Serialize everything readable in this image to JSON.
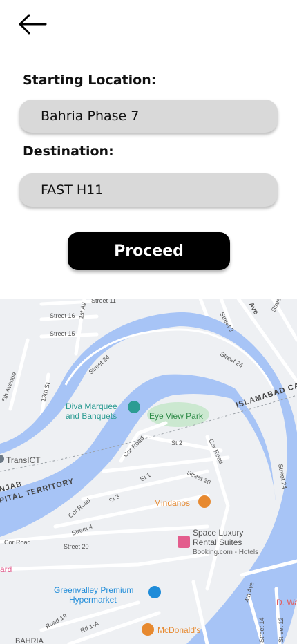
{
  "header": {
    "back_icon": "arrow-left-icon"
  },
  "form": {
    "start_label": "Starting Location:",
    "start_value": "Bahria Phase 7",
    "destination_label": "Destination:",
    "destination_value": "FAST H11",
    "proceed_label": "Proceed"
  },
  "map": {
    "streets": {
      "street_11": "Street 11",
      "street_16": "Street 16",
      "street_15": "Street 15",
      "street_24_a": "Street 24",
      "street_24_b": "Street 24",
      "street_24_c": "Street 24",
      "street_2": "Street 2",
      "street_17a": "Street 17A",
      "ave_a": "Ave",
      "ave_b": "1st Av",
      "sixth_avenue": "6th Avenue",
      "thirteenth_st": "13th St",
      "cor_road_a": "Cor Road",
      "cor_road_b": "Cor Road",
      "cor_road_c": "Cor Road",
      "cor_road_d": "Cor Road",
      "st_2": "St 2",
      "st_1": "St 1",
      "st_3": "St 3",
      "street_20_a": "Street 20",
      "street_20_b": "Street 20",
      "street_4": "Street 4",
      "forty_fourth_ave": "4th Ave",
      "road_19": "Road 19",
      "rd_1a": "Rd 1-A",
      "street_14": "Street 14",
      "street_12": "Street 12"
    },
    "regions": {
      "islamabad": "ISLAMABAD CA",
      "punjab": "NJAB",
      "capital": "PITAL TERRITORY"
    },
    "places": {
      "diva_line1": "Diva Marquee",
      "diva_line2": "and Banquets",
      "eye_view": "Eye View Park",
      "transict": "TransICT",
      "mindanos": "Mindanos",
      "space_line1": "Space Luxury",
      "space_line2": "Rental Suites",
      "space_sub": "Booking.com - Hotels",
      "greenvalley_line1": "Greenvalley Premium",
      "greenvalley_line2": "Hypermarket",
      "mcdonalds": "McDonald's",
      "ward": "ard",
      "dwa": "D. Wa",
      "bahria": "BAHRIA"
    },
    "colors": {
      "water": "#a7c4f6",
      "road": "#ffffff",
      "park": "#cbe8d0",
      "land": "#eef0f3",
      "poi_food": "#e7892f",
      "poi_hotel": "#e35d8d",
      "poi_shop": "#1f8cd9",
      "poi_teal": "#2c9c93"
    }
  }
}
